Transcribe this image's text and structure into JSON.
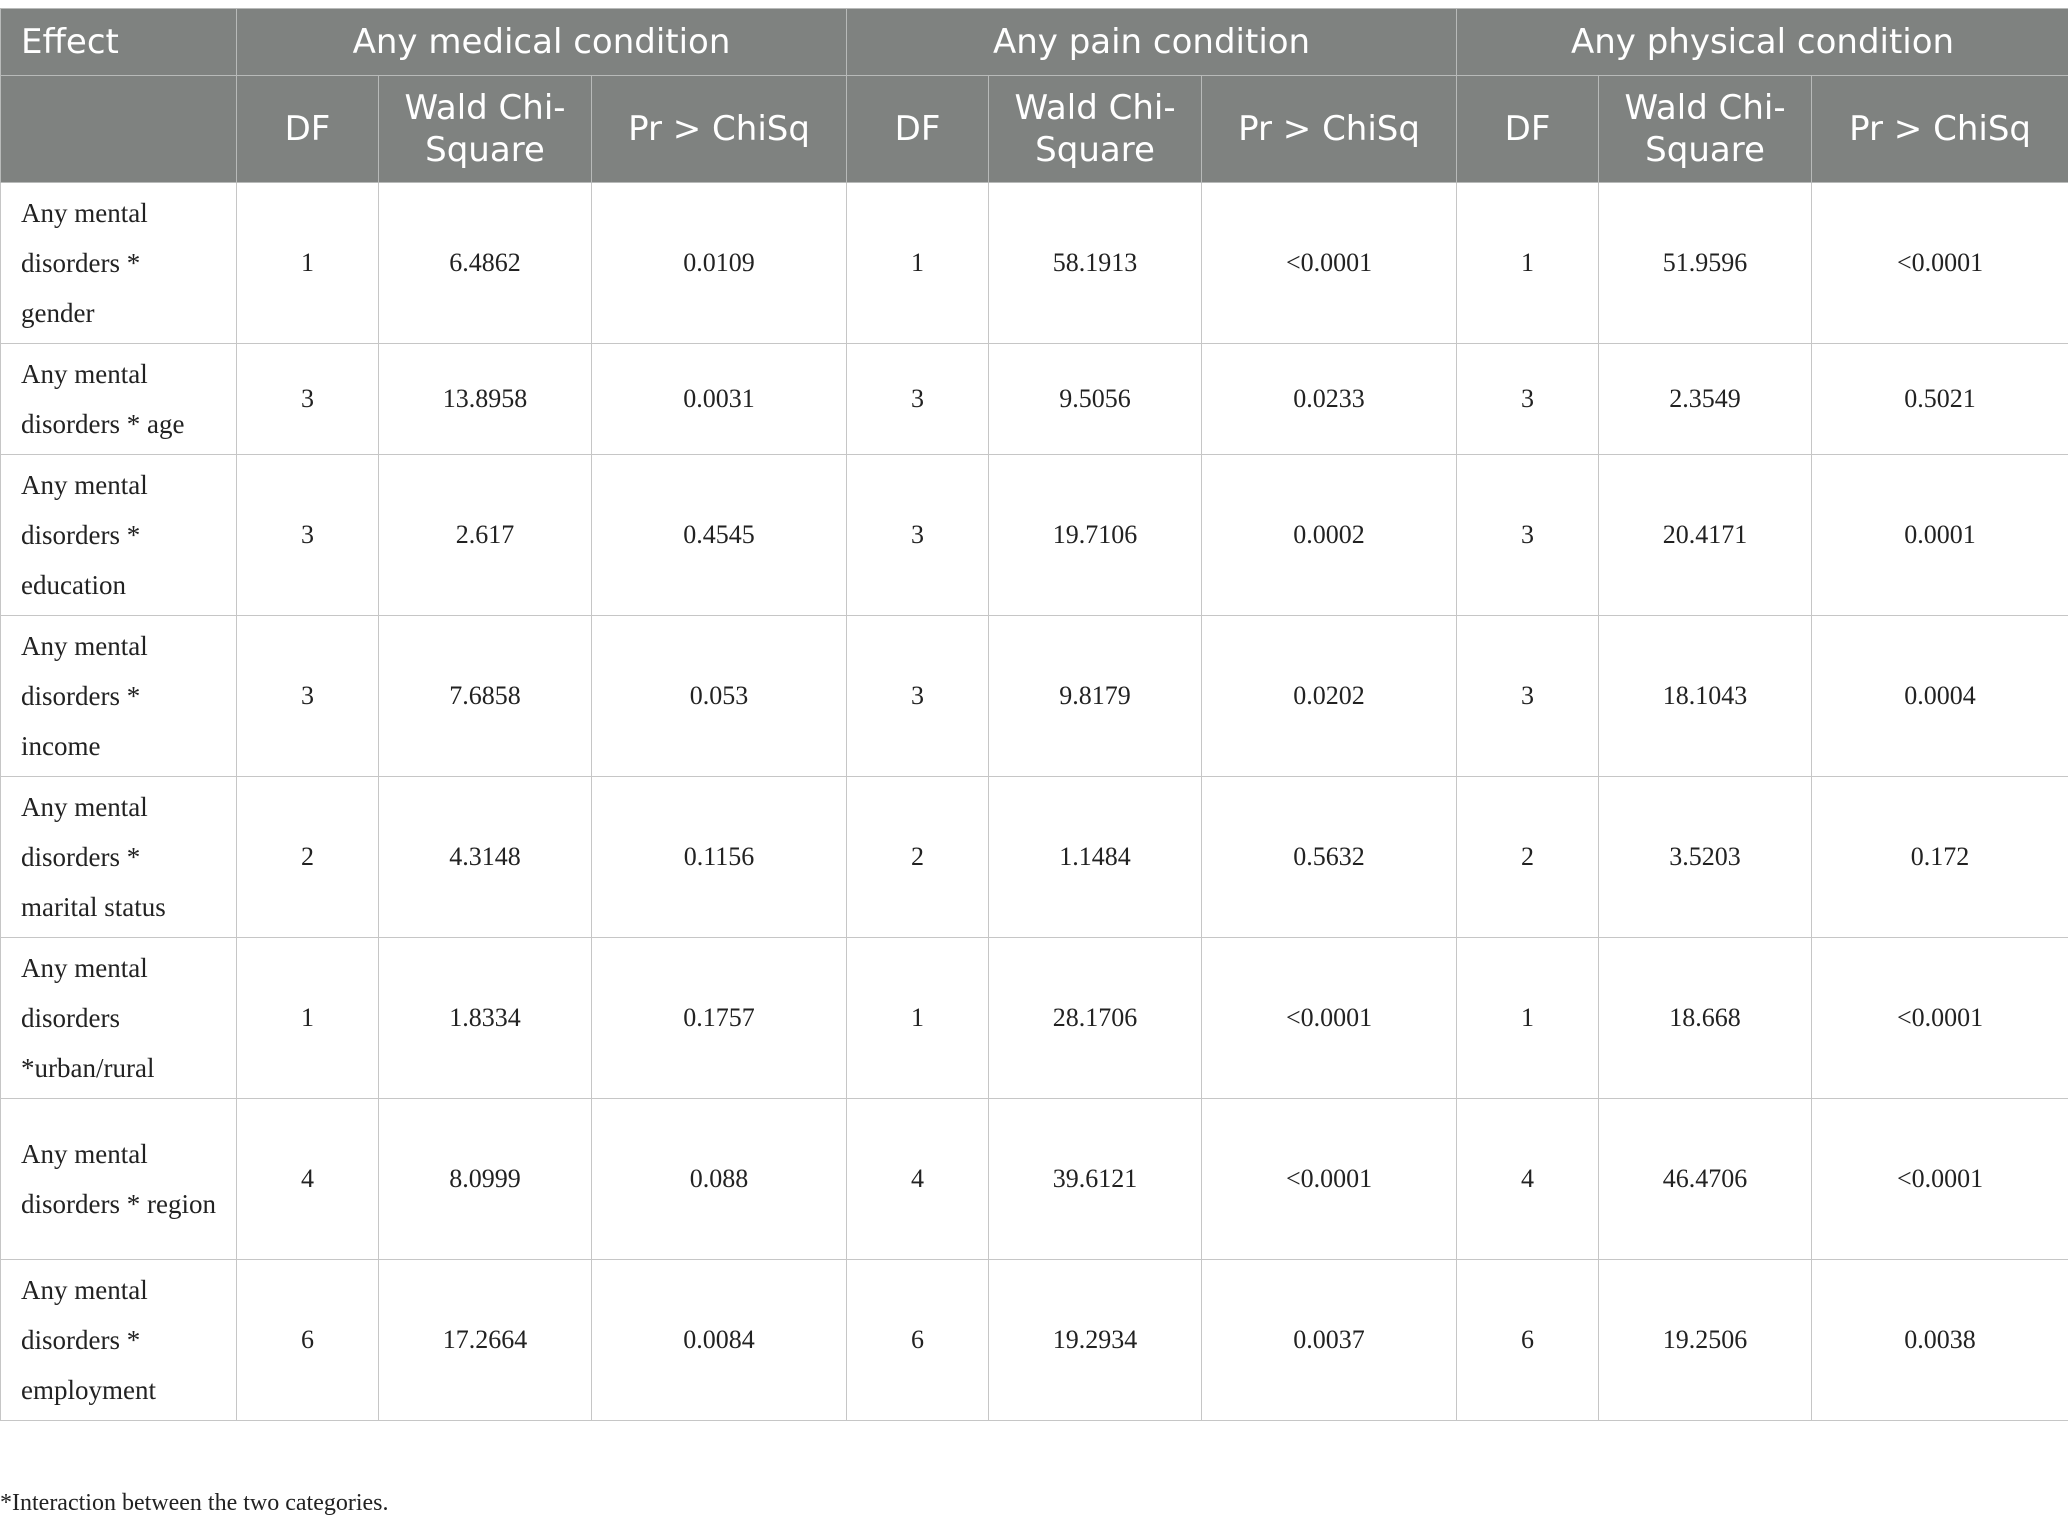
{
  "table": {
    "effect_header": "Effect",
    "groups": [
      "Any medical condition",
      "Any pain condition",
      "Any physical condition"
    ],
    "subheaders": [
      "DF",
      "Wald Chi-Square",
      "Pr > ChiSq"
    ],
    "rows": [
      {
        "effect": "Any mental disorders * gender",
        "cells": [
          "1",
          "6.4862",
          "0.0109",
          "1",
          "58.1913",
          "<0.0001",
          "1",
          "51.9596",
          "<0.0001"
        ]
      },
      {
        "effect": "Any mental disorders * age",
        "cells": [
          "3",
          "13.8958",
          "0.0031",
          "3",
          "9.5056",
          "0.0233",
          "3",
          "2.3549",
          "0.5021"
        ]
      },
      {
        "effect": "Any mental disorders * education",
        "cells": [
          "3",
          "2.617",
          "0.4545",
          "3",
          "19.7106",
          "0.0002",
          "3",
          "20.4171",
          "0.0001"
        ]
      },
      {
        "effect": "Any mental disorders * income",
        "cells": [
          "3",
          "7.6858",
          "0.053",
          "3",
          "9.8179",
          "0.0202",
          "3",
          "18.1043",
          "0.0004"
        ]
      },
      {
        "effect": "Any mental disorders * marital status",
        "cells": [
          "2",
          "4.3148",
          "0.1156",
          "2",
          "1.1484",
          "0.5632",
          "2",
          "3.5203",
          "0.172"
        ]
      },
      {
        "effect": "Any mental disorders *urban/rural",
        "cells": [
          "1",
          "1.8334",
          "0.1757",
          "1",
          "28.1706",
          "<0.0001",
          "1",
          "18.668",
          "<0.0001"
        ]
      },
      {
        "effect": "Any mental disorders * region",
        "cells": [
          "4",
          "8.0999",
          "0.088",
          "4",
          "39.6121",
          "<0.0001",
          "4",
          "46.4706",
          "<0.0001"
        ]
      },
      {
        "effect": "Any mental disorders * employment",
        "cells": [
          "6",
          "17.2664",
          "0.0084",
          "6",
          "19.2934",
          "0.0037",
          "6",
          "19.2506",
          "0.0038"
        ]
      }
    ]
  },
  "footnote": "*Interaction between the two categories."
}
